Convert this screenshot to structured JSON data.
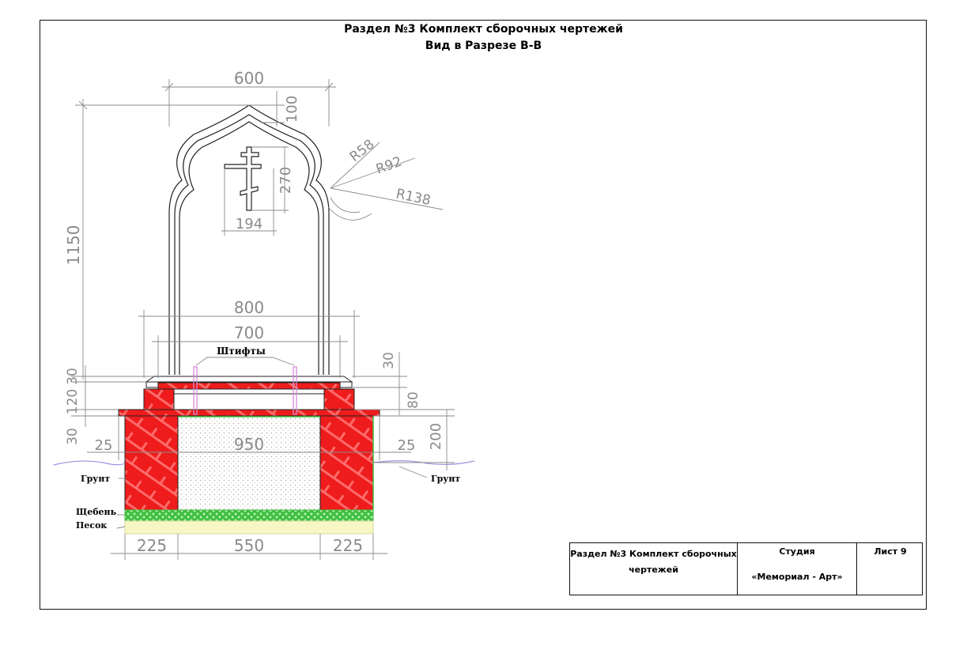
{
  "header": {
    "title_line1": "Раздел №3 Комплект сборочных чертежей",
    "title_line2": "Вид в Разрезе В-В"
  },
  "drawing": {
    "dimensions": {
      "width_stele": "600",
      "top_arch": "100",
      "height_total": "1150",
      "cross_height": "270",
      "cross_width": "194",
      "radius_small": "R58",
      "radius_mid": "R92",
      "radius_large": "R138",
      "base_width": "800",
      "pin_span": "700",
      "plate_thickness": "30",
      "plate_right": "30",
      "slab_right": "80",
      "slab_left": "120",
      "border_top": "30",
      "edge_left": "25",
      "edge_right": "25",
      "inner_width": "950",
      "depth": "200",
      "bottom_left": "225",
      "bottom_mid": "550",
      "bottom_right": "225"
    },
    "labels": {
      "pins": "Штифты",
      "soil_left": "Грунт",
      "soil_right": "Грунт",
      "gravel": "Щебень",
      "sand": "Песок"
    },
    "colors": {
      "concrete": "#ee1c1c",
      "gravel": "#3fbf3f",
      "sand": "#f7f7c6",
      "dimension": "#8a8a8a",
      "pins": "#d58ad5",
      "ground_line": "#9a94e0"
    }
  },
  "stamp": {
    "section": "Раздел №3 Комплект сборочных чертежей",
    "studio_label": "Студия",
    "studio_name": "«Мемориал - Арт»",
    "sheet": "Лист 9"
  }
}
